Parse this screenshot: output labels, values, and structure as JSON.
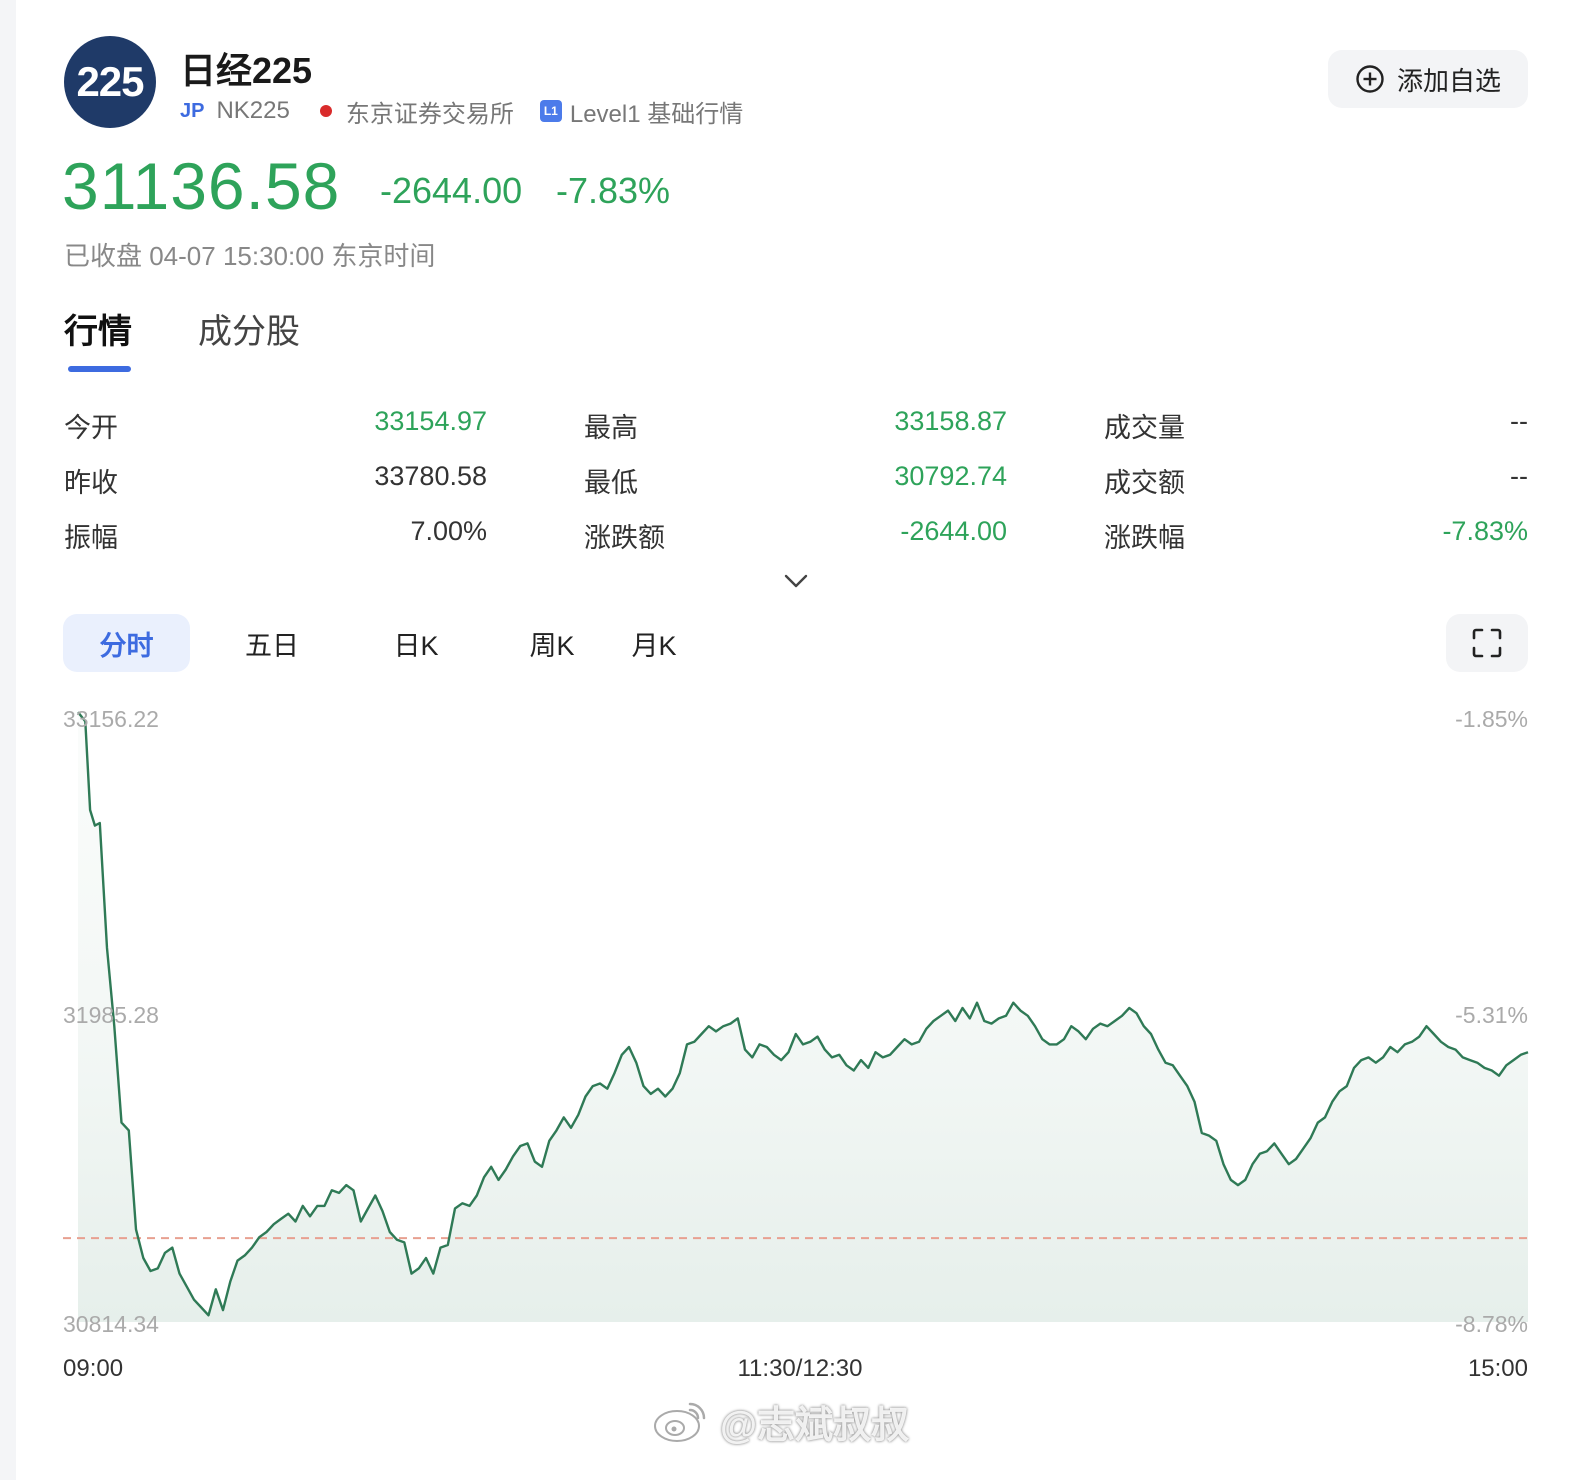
{
  "header": {
    "logo_text": "225",
    "title": "日经225",
    "region_badge": "JP",
    "code": "NK225",
    "exchange": "东京证券交易所",
    "level_badge": "L1",
    "level_text": "Level1 基础行情",
    "add_button_label": "添加自选"
  },
  "quote": {
    "price": "31136.58",
    "change": "-2644.00",
    "change_pct": "-7.83%",
    "status": "已收盘 04-07 15:30:00 东京时间",
    "up_color": "#2ea35a"
  },
  "tabs": [
    {
      "label": "行情",
      "active": true
    },
    {
      "label": "成分股",
      "active": false
    }
  ],
  "stats": [
    {
      "label": "今开",
      "value": "33154.97",
      "color": "green"
    },
    {
      "label": "最高",
      "value": "33158.87",
      "color": "green"
    },
    {
      "label": "成交量",
      "value": "--",
      "color": "dark"
    },
    {
      "label": "昨收",
      "value": "33780.58",
      "color": "dark"
    },
    {
      "label": "最低",
      "value": "30792.74",
      "color": "green"
    },
    {
      "label": "成交额",
      "value": "--",
      "color": "dark"
    },
    {
      "label": "振幅",
      "value": "7.00%",
      "color": "dark"
    },
    {
      "label": "涨跌额",
      "value": "-2644.00",
      "color": "green"
    },
    {
      "label": "涨跌幅",
      "value": "-7.83%",
      "color": "green"
    }
  ],
  "periods": [
    {
      "label": "分时",
      "active": true
    },
    {
      "label": "五日",
      "active": false
    },
    {
      "label": "日K",
      "active": false
    },
    {
      "label": "周K",
      "active": false
    },
    {
      "label": "月K",
      "active": false
    }
  ],
  "chart_data": {
    "type": "area",
    "y_left_ticks": [
      "33156.22",
      "31985.28",
      "30814.34"
    ],
    "y_right_ticks": [
      "-1.85%",
      "-5.31%",
      "-8.78%"
    ],
    "x_ticks": [
      "09:00",
      "11:30/12:30",
      "15:00"
    ],
    "ylim": [
      30814.34,
      33156.22
    ],
    "reference_value": 31136.58,
    "line_color": "#2f7a56",
    "reference_color": "#e8a090",
    "x": [
      0,
      1.5,
      2.5,
      3.5,
      4.5,
      6,
      7.5,
      9,
      10.5,
      12,
      13.5,
      15,
      16.5,
      18,
      19.5,
      21,
      22.5,
      24,
      25.5,
      27,
      28.5,
      30,
      31.5,
      33,
      34.5,
      36,
      37.5,
      39,
      40.5,
      42,
      43.5,
      45,
      46.5,
      48,
      49.5,
      51,
      52.5,
      54,
      55.5,
      57,
      58.5,
      60,
      61.5,
      63,
      64.5,
      66,
      67.5,
      69,
      70.5,
      72,
      73.5,
      75,
      76.5,
      78,
      79.5,
      81,
      82.5,
      84,
      85.5,
      87,
      88.5,
      90,
      91.5,
      93,
      94.5,
      96,
      97.5,
      99,
      100.5,
      102,
      103.5,
      105,
      106.5,
      108,
      109.5,
      111,
      112.5,
      114,
      115.5,
      117,
      118.5,
      120,
      121.5,
      123,
      124.5,
      126,
      127.5,
      129,
      130.5,
      132,
      133.5,
      135,
      136.5,
      138,
      139.5,
      141,
      142.5,
      144,
      145.5,
      147,
      148.5,
      150,
      151.5,
      153,
      154.5,
      156,
      157.5,
      159,
      160.5,
      162,
      163.5,
      165,
      166.5,
      168,
      169.5,
      171,
      172.5,
      174,
      175.5,
      177,
      178.5,
      180,
      181.5,
      183,
      184.5,
      186,
      187.5,
      189,
      190.5,
      192,
      193.5,
      195,
      196.5,
      198,
      199.5,
      201,
      202.5,
      204,
      205.5,
      207,
      208.5,
      210,
      211.5,
      213,
      214.5,
      216,
      217.5,
      219,
      220.5,
      222,
      223.5,
      225,
      226.5,
      228,
      229.5,
      231,
      232.5,
      234,
      235.5,
      237,
      238.5,
      240,
      241.5,
      243,
      244.5,
      246,
      247.5,
      249,
      250.5,
      252,
      253.5,
      255,
      256.5,
      258,
      259.5,
      261,
      262.5,
      264,
      265.5,
      267,
      268.5,
      270,
      271.5,
      273,
      274.5,
      276,
      277.5,
      279,
      280.5,
      282,
      283.5,
      285,
      286.5,
      288,
      289.5,
      291,
      292.5,
      294,
      295.5,
      297,
      298.5,
      300
    ],
    "values": [
      33156,
      33120,
      32780,
      32720,
      32730,
      32250,
      31950,
      31580,
      31550,
      31170,
      31060,
      31010,
      31020,
      31080,
      31100,
      31000,
      30950,
      30900,
      30870,
      30840,
      30940,
      30860,
      30970,
      31050,
      31070,
      31100,
      31140,
      31160,
      31190,
      31210,
      31230,
      31200,
      31260,
      31220,
      31260,
      31260,
      31320,
      31310,
      31340,
      31320,
      31200,
      31250,
      31300,
      31240,
      31160,
      31130,
      31120,
      31000,
      31020,
      31060,
      31000,
      31100,
      31110,
      31250,
      31270,
      31260,
      31300,
      31370,
      31410,
      31360,
      31400,
      31450,
      31490,
      31500,
      31430,
      31410,
      31510,
      31550,
      31600,
      31560,
      31610,
      31680,
      31720,
      31730,
      31710,
      31770,
      31840,
      31870,
      31810,
      31720,
      31690,
      31710,
      31680,
      31710,
      31770,
      31880,
      31890,
      31920,
      31950,
      31930,
      31950,
      31960,
      31980,
      31860,
      31830,
      31880,
      31870,
      31840,
      31820,
      31850,
      31920,
      31880,
      31890,
      31910,
      31860,
      31830,
      31840,
      31800,
      31780,
      31820,
      31790,
      31850,
      31830,
      31840,
      31870,
      31900,
      31880,
      31890,
      31940,
      31970,
      31990,
      32010,
      31970,
      32020,
      31980,
      32040,
      31970,
      31960,
      31980,
      31990,
      32040,
      32010,
      31990,
      31950,
      31900,
      31880,
      31880,
      31900,
      31950,
      31930,
      31900,
      31940,
      31960,
      31950,
      31970,
      31990,
      32020,
      32000,
      31950,
      31920,
      31860,
      31810,
      31800,
      31760,
      31720,
      31660,
      31540,
      31530,
      31510,
      31420,
      31360,
      31340,
      31360,
      31420,
      31460,
      31470,
      31500,
      31460,
      31420,
      31440,
      31480,
      31520,
      31580,
      31600,
      31660,
      31700,
      31720,
      31790,
      31820,
      31830,
      31810,
      31830,
      31870,
      31850,
      31880,
      31890,
      31910,
      31950,
      31920,
      31890,
      31870,
      31860,
      31830,
      31820,
      31810,
      31790,
      31780,
      31760,
      31800,
      31820,
      31840,
      31850,
      31870,
      31900,
      31920,
      31980
    ]
  }
}
